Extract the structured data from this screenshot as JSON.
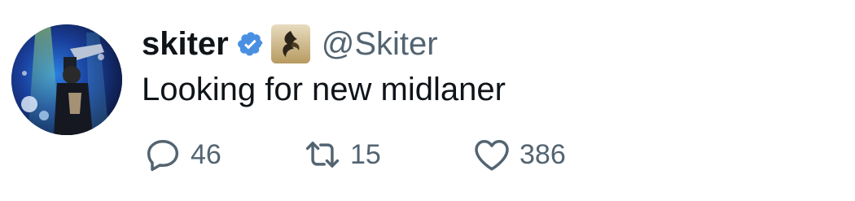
{
  "tweet": {
    "author": {
      "display_name": "skiter",
      "handle": "@Skiter",
      "verified_color": "#4a90e2"
    },
    "text": "Looking for new midlaner",
    "stats": {
      "replies": "46",
      "retweets": "15",
      "likes": "386"
    },
    "icons": {
      "reply": "reply-icon",
      "retweet": "retweet-icon",
      "like": "heart-icon"
    }
  }
}
